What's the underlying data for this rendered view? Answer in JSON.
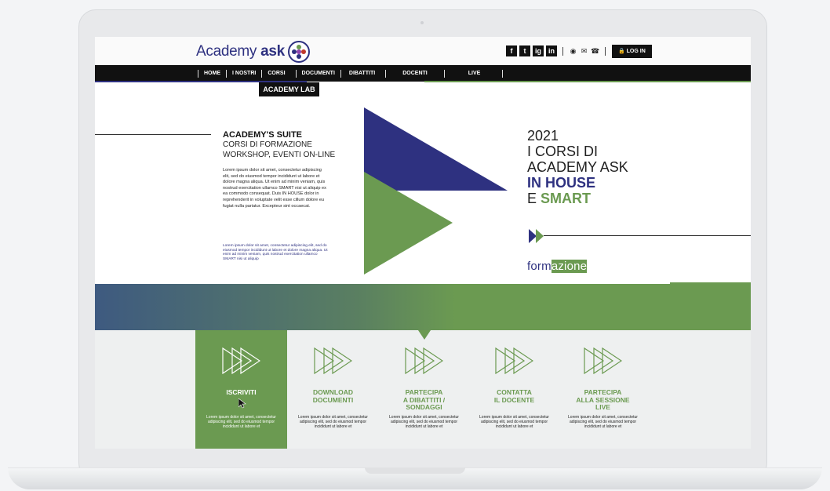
{
  "header": {
    "logo_text": "Academy",
    "logo_bold": "ask",
    "social": [
      "f",
      "t",
      "ig",
      "in"
    ],
    "contact_icons": [
      "map-pin-icon",
      "mail-icon",
      "phone-icon"
    ],
    "login_label": "🔒 LOG IN"
  },
  "nav": {
    "items": [
      "HOME",
      "I NOSTRI",
      "CORSI",
      "DOCUMENTI",
      "DIBATTITI",
      "DOCENTI",
      "LIVE"
    ],
    "submenu": "ACADEMY LAB"
  },
  "hero": {
    "title": "ACADEMY'S SUITE",
    "subtitle_1": "CORSI DI FORMAZIONE",
    "subtitle_2": "WORKSHOP, EVENTI ON-LINE",
    "body": "Lorem ipsum dolor sit amet, consectetur adipiscing elit, sed do eiusmod tempor incididunt ut labore et dolore magna aliqua. Ut enim ad minim veniam, quis nostrud exercitation ullamco SMART nisi ut aliquip ex ea commodo consequat. Duis IN HOUSE dolor in reprehenderit in voluptate velit esse cillum dolore eu fugiat nulla pariatur. Excepteur sint occaecat.",
    "small": "Lorem ipsum dolor sit amet, consectetur adipiscing elit, sed do eiusmod tempor incididunt ut labore et dolore magna aliqua. Ut enim ad minim veniam, quis nostrud exercitation ullamco SMART nisi ut aliquip",
    "year": "2021",
    "line_2": "I CORSI DI",
    "line_3": "ACADEMY ASK",
    "line_4": "IN HOUSE",
    "line_5_pre": "E ",
    "line_5_bold": "SMART",
    "formazione_pre": "form",
    "formazione_hl": "azione"
  },
  "steps": [
    {
      "title": "ISCRIVITI",
      "desc": "Lorem ipsum dolor sit amet, consectetur adipiscing elit, sed do eiusmod tempor incididunt ut labore et"
    },
    {
      "title": "DOWNLOAD\nDOCUMENTI",
      "desc": "Lorem ipsum dolor sit amet, consectetur adipiscing elit, sed do eiusmod tempor incididunt ut labore et"
    },
    {
      "title": "PARTECIPA\nA DIBATTITI /\nSONDAGGI",
      "desc": "Lorem ipsum dolor sit amet, consectetur adipiscing elit, sed do eiusmod tempor incididunt ut labore et"
    },
    {
      "title": "CONTATTA\nIL DOCENTE",
      "desc": "Lorem ipsum dolor sit amet, consectetur adipiscing elit, sed do eiusmod tempor incididunt ut labore et"
    },
    {
      "title": "PARTECIPA\nALLA SESSIONE\nLIVE",
      "desc": "Lorem ipsum dolor sit amet, consectetur adipiscing elit, sed do eiusmod tempor incididunt ut labore et"
    }
  ],
  "colors": {
    "blue": "#2e3180",
    "green": "#6b9a51",
    "black": "#111111"
  }
}
